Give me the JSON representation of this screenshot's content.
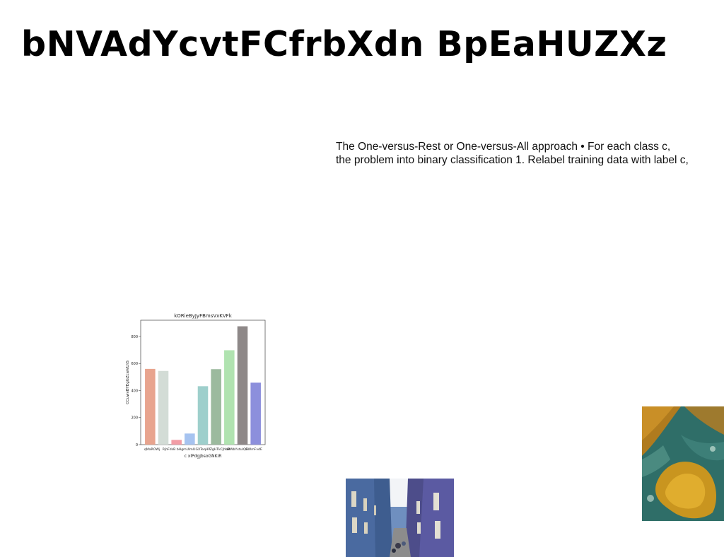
{
  "page": {
    "title": "bNVAdYcvtFCfrbXdn BpEaHUZXz",
    "body_lines": [
      "The One-versus-Rest or One-versus-All approach • For each class c,",
      "the problem into binary classification 1. Relabel training data with label c,"
    ]
  },
  "chart_data": {
    "type": "bar",
    "title": "kORieByJyFBmsVxKVFk",
    "xlabel": "c xlPdgjbsoGNKiR",
    "ylabel": "CCuwvBYEgGZcwVLhS",
    "categories": [
      "qMaROWj",
      "RjhFdsB",
      "bHgmUlmU",
      "GXTeqHR",
      "ZgHTkCJhUP",
      "aBWbYxtulQR",
      "GWmFvdE",
      ""
    ],
    "tick_labels": [
      "qMaROWj",
      "RjhFdsB",
      "bHgmUlmU",
      "GXTeqHR",
      "ZgHTkCJhUP",
      "aBWbYxtulQR",
      "GWmFvdE"
    ],
    "values": [
      560,
      545,
      35,
      82,
      432,
      558,
      698,
      875,
      458
    ],
    "colors": [
      "#e8a48e",
      "#d3dcd6",
      "#f29da6",
      "#a6c3f0",
      "#9ecfcc",
      "#9cba9e",
      "#b0e3b0",
      "#8e8888",
      "#8c8fdc"
    ],
    "ylim": [
      0,
      920
    ],
    "yticks": [
      0,
      200,
      400,
      600,
      800
    ],
    "grid": false
  },
  "images": {
    "street_photo": "street-photo",
    "aerial_photo": "aerial-photo"
  }
}
